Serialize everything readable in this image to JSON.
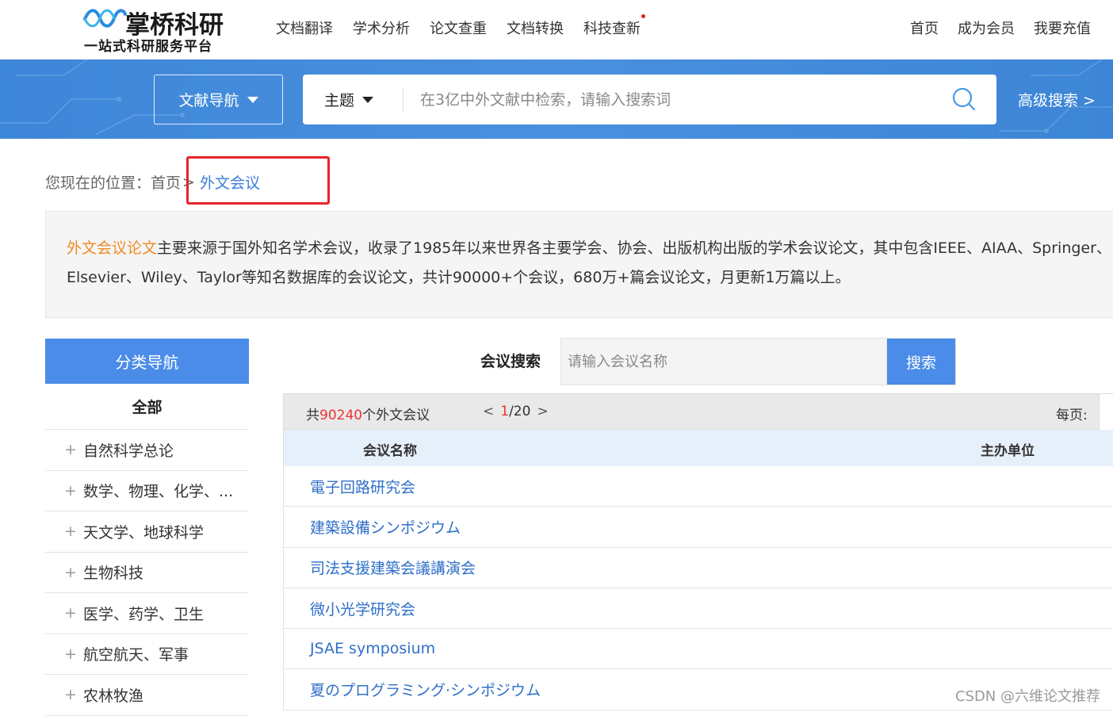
{
  "header": {
    "logo_name": "掌桥科研",
    "logo_slogan": "一站式科研服务平台",
    "nav": [
      "文档翻译",
      "学术分析",
      "论文查重",
      "文档转换",
      "科技查新"
    ],
    "right_nav": [
      "首页",
      "成为会员",
      "我要充值"
    ]
  },
  "search": {
    "nav_select": "文献导航",
    "scope": "主题",
    "placeholder": "在3亿中外文献中检索，请输入搜索词",
    "advanced": "高级搜索 >"
  },
  "breadcrumb": {
    "prefix": "您现在的位置：",
    "home": "首页",
    "separator": ">",
    "current": "外文会议"
  },
  "intro": {
    "lead": "外文会议论文",
    "line1_rest": "主要来源于国外知名学术会议，收录了1985年以来世界各主要学会、协会、出版机构出版的学术会议论文，其中包含IEEE、AIAA、Springer、",
    "line2": "Elsevier、Wiley、Taylor等知名数据库的会议论文，共计90000+个会议，680万+篇会议论文，月更新1万篇以上。"
  },
  "category": {
    "header": "分类导航",
    "all": "全部",
    "items": [
      "自然科学总论",
      "数学、物理、化学、...",
      "天文学、地球科学",
      "生物科技",
      "医学、药学、卫生",
      "航空航天、军事",
      "农林牧渔"
    ]
  },
  "conference_search": {
    "label": "会议搜索",
    "placeholder": "请输入会议名称",
    "button": "搜索"
  },
  "results": {
    "total_prefix": "共",
    "total_count": "90240",
    "total_suffix": "个外文会议",
    "page_current": "1",
    "page_total": "/20",
    "per_page_label": "每页:",
    "col_name": "会议名称",
    "col_org": "主办单位",
    "rows": [
      "電子回路研究会",
      "建築設備シンポジウム",
      "司法支援建築会議講演会",
      "微小光学研究会",
      "JSAE symposium",
      "夏のプログラミング·シンポジウム"
    ]
  },
  "watermark": "CSDN @六维论文推荐",
  "colors": {
    "brand_blue": "#4a8ce8",
    "link_blue": "#2f6fc9",
    "accent_orange": "#f08a24",
    "count_red": "#e33333",
    "highlight_red": "#e8242a"
  }
}
